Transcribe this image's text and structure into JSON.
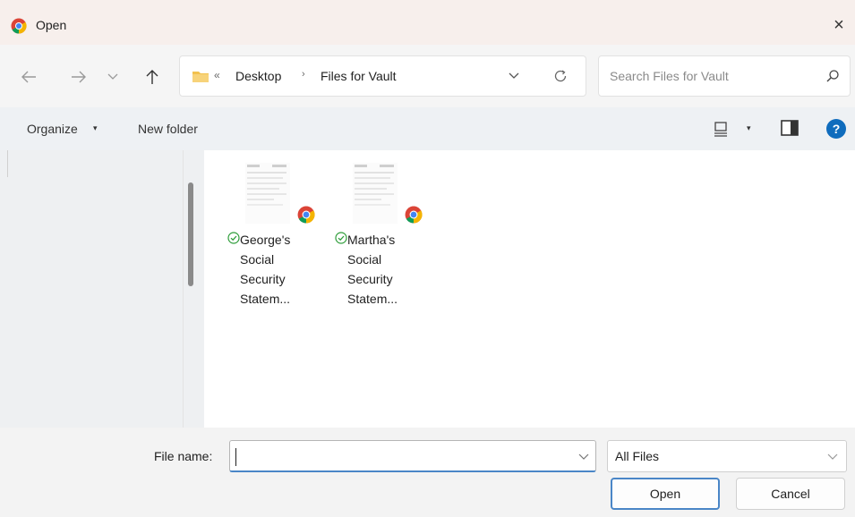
{
  "window": {
    "title": "Open",
    "close_label": "×"
  },
  "nav": {
    "back_icon": "back-arrow-icon",
    "forward_icon": "forward-arrow-icon",
    "recent_icon": "chevron-down-icon",
    "up_icon": "up-arrow-icon"
  },
  "address": {
    "overflow": "«",
    "crumbs": [
      "Desktop",
      "Files for Vault"
    ],
    "chevron": "›"
  },
  "search": {
    "placeholder": "Search Files for Vault"
  },
  "toolbar": {
    "organize_label": "Organize",
    "organize_caret": "▾",
    "new_folder_label": "New folder",
    "view_caret": "▾"
  },
  "files": [
    {
      "lines": [
        "George's",
        "Social",
        "Security",
        "Statem..."
      ]
    },
    {
      "lines": [
        "Martha's",
        "Social",
        "Security",
        "Statem..."
      ]
    }
  ],
  "bottom": {
    "file_name_label": "File name:",
    "file_name_value": "",
    "file_type_value": "All Files",
    "open_label": "Open",
    "cancel_label": "Cancel"
  },
  "colors": {
    "accent": "#4a86c7",
    "help_blue": "#0f6cbd",
    "sync_green": "#2e9d3a",
    "folder_yellow": "#f2c14e"
  }
}
